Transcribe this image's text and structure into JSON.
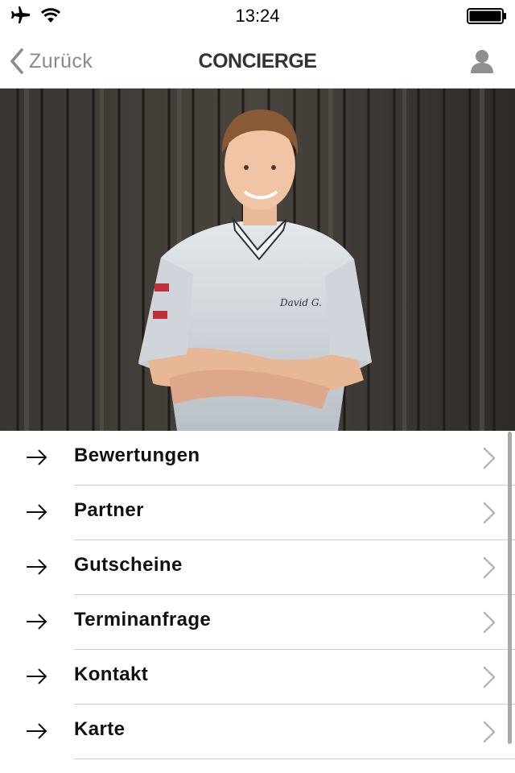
{
  "status_bar": {
    "time": "13:24",
    "icons": [
      "airplane-icon",
      "wifi-icon",
      "battery-icon"
    ]
  },
  "nav_bar": {
    "back_label": "Zurück",
    "title": "CONCIERGE",
    "right_icon": "profile-icon"
  },
  "hero": {
    "icon": "chef-portrait-image"
  },
  "menu": {
    "items": [
      {
        "label": "Bewertungen"
      },
      {
        "label": "Partner"
      },
      {
        "label": "Gutscheine"
      },
      {
        "label": "Terminanfrage"
      },
      {
        "label": "Kontakt"
      },
      {
        "label": "Karte"
      }
    ]
  },
  "colors": {
    "accent": "#8a8a8a",
    "text": "#111111",
    "divider": "#cfcfcf"
  }
}
